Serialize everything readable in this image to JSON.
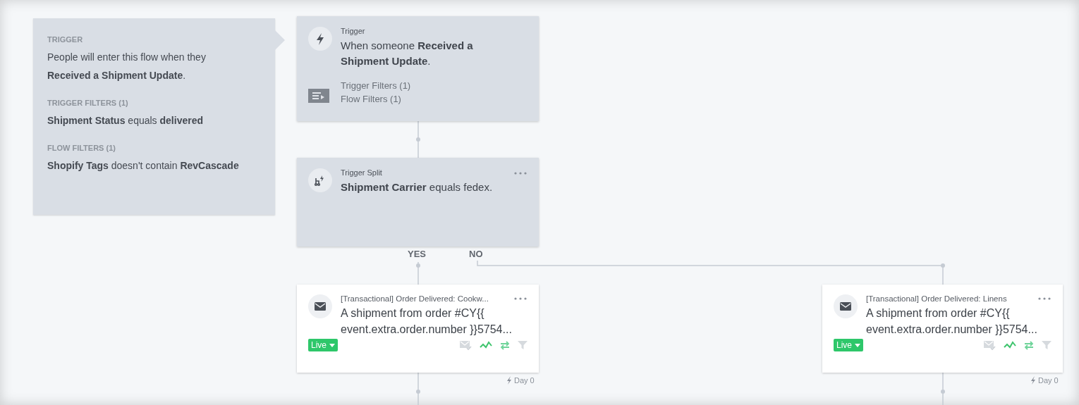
{
  "info_panel": {
    "sections": [
      {
        "heading": "TRIGGER",
        "text": "People will enter this flow when they **Received a Shipment Update**."
      },
      {
        "heading": "TRIGGER FILTERS (1)",
        "text": "**Shipment Status** equals **delivered**"
      },
      {
        "heading": "FLOW FILTERS (1)",
        "text": "**Shopify Tags** doesn't contain **RevCascade**"
      }
    ]
  },
  "trigger_node": {
    "label": "Trigger",
    "text": "When someone **Received a Shipment Update**.",
    "filters": [
      "Trigger Filters (1)",
      "Flow Filters (1)"
    ]
  },
  "split_node": {
    "label": "Trigger Split",
    "text": "**Shipment Carrier** equals fedex.",
    "branches": [
      "YES",
      "NO"
    ]
  },
  "email_nodes": [
    {
      "title": "[Transactional] Order Delivered: Cookw...",
      "preview": "A shipment from order #CY{{ event.extra.order.number }}5754...",
      "status": "Live",
      "delay": "Day 0"
    },
    {
      "title": "[Transactional] Order Delivered: Linens",
      "preview": "A shipment from order #CY{{ event.extra.order.number }}5754...",
      "status": "Live",
      "delay": "Day 0"
    }
  ]
}
